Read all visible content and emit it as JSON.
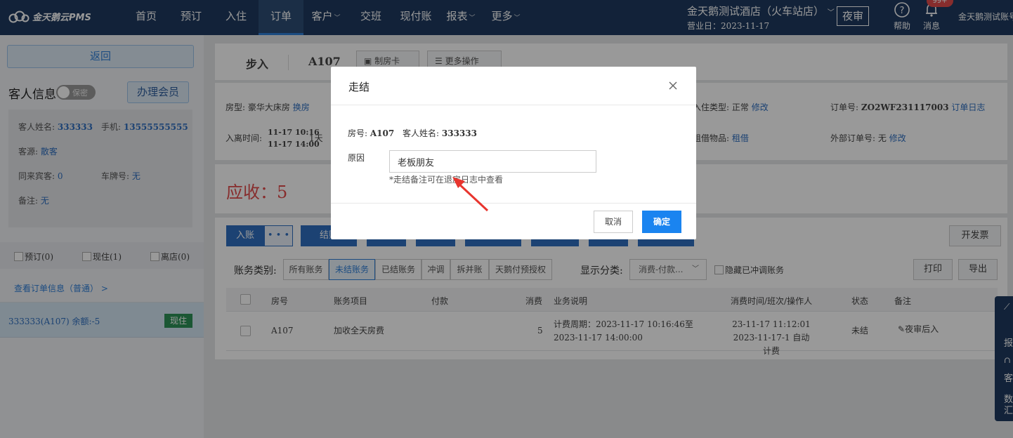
{
  "topbar": {
    "logo_text": "金天鹅云PMS",
    "nav": [
      {
        "label": "首页",
        "chevron": false
      },
      {
        "label": "预订",
        "chevron": false
      },
      {
        "label": "入住",
        "chevron": false
      },
      {
        "label": "订单",
        "chevron": false,
        "active": true
      },
      {
        "label": "客户",
        "chevron": true
      },
      {
        "label": "交班",
        "chevron": false
      },
      {
        "label": "现付账",
        "chevron": false
      },
      {
        "label": "报表",
        "chevron": true
      },
      {
        "label": "更多",
        "chevron": true
      }
    ],
    "hotel_name": "金天鹅测试酒店（火车站店）",
    "business_day": "营业日：2023-11-17",
    "night_audit": "夜审",
    "help": "帮助",
    "messages": "消息",
    "badge": "99+",
    "account": "金天鹅测试账号"
  },
  "sidebar": {
    "back": "返回",
    "guest_info_title": "客人信息",
    "privacy_toggle": "保密",
    "member_button": "办理会员",
    "guest_name_label": "客人姓名:",
    "guest_name": "333333",
    "phone_label": "手机:",
    "phone": "13555555555",
    "source_label": "客源:",
    "source": "散客",
    "companions_label": "同来宾客:",
    "companions": "0",
    "plate_label": "车牌号:",
    "plate": "无",
    "remark_label": "备注:",
    "remark": "无",
    "status_reserve": "预订(0)",
    "status_in": "现住(1)",
    "status_out": "离店(0)",
    "order_link": "查看订单信息（普通） >",
    "guest_row": "333333(A107)   余额:-5",
    "guest_tag": "现住"
  },
  "header": {
    "walk_in": "步入",
    "room": "A107",
    "make_card": "制房卡",
    "more_actions": "更多操作"
  },
  "info": {
    "room_type_label": "房型:",
    "room_type": "豪华大床房",
    "change_room": "换房",
    "stay_label": "入离时间:",
    "checkin_time": "11-17 10:16",
    "checkout_time": "11-17 14:00",
    "nights": "1天",
    "checkin_type_label": "入住类型:",
    "checkin_type": "正常",
    "modify": "修改",
    "rental_label": "租借物品:",
    "rental": "租借",
    "order_no_label": "订单号:",
    "order_no": "ZO2WF231117003",
    "order_log": "订单日志",
    "ext_order_label": "外部订单号:",
    "ext_order": "无",
    "ext_modify": "修改"
  },
  "receivable": "应收：5",
  "actions": {
    "post": "入账",
    "more": "• • •",
    "settle": "结账",
    "invoice": "开发票"
  },
  "filters": {
    "category_label": "账务类别:",
    "categories": [
      "所有账务",
      "未结账务",
      "已结账务",
      "冲调",
      "拆并账",
      "天鹅付预授权"
    ],
    "display_label": "显示分类:",
    "display_value": "消费-付款...",
    "hide_reversed": "隐藏已冲调账务",
    "print": "打印",
    "export": "导出"
  },
  "table": {
    "headers": [
      "房号",
      "账务项目",
      "付款",
      "消费",
      "业务说明",
      "消费时间/班次/操作人",
      "状态",
      "备注"
    ],
    "rows": [
      {
        "room": "A107",
        "item": "加收全天房费",
        "payment": "",
        "consume": "5",
        "desc1": "计费周期：2023-11-17 10:16:46至",
        "desc2": "2023-11-17 14:00:00",
        "time1": "23-11-17 11:12:01",
        "time2": "2023-11-17-1 自动计费",
        "status": "未结",
        "remark": "夜审后入"
      }
    ]
  },
  "float_panel": [
    "报",
    "客",
    "数",
    "汇"
  ],
  "modal": {
    "title": "走结",
    "room_label": "房号:",
    "room": "A107",
    "guest_label": "客人姓名:",
    "guest": "333333",
    "reason_label": "原因",
    "reason_value": "老板朋友",
    "hint": "*走结备注可在退房日志中查看",
    "cancel": "取消",
    "ok": "确定"
  },
  "colors": {
    "topbar": "#1e3a5f",
    "primary": "#2f6fc0",
    "confirm": "#1a84f0",
    "danger": "#e24b4b",
    "success": "#2e9157"
  }
}
